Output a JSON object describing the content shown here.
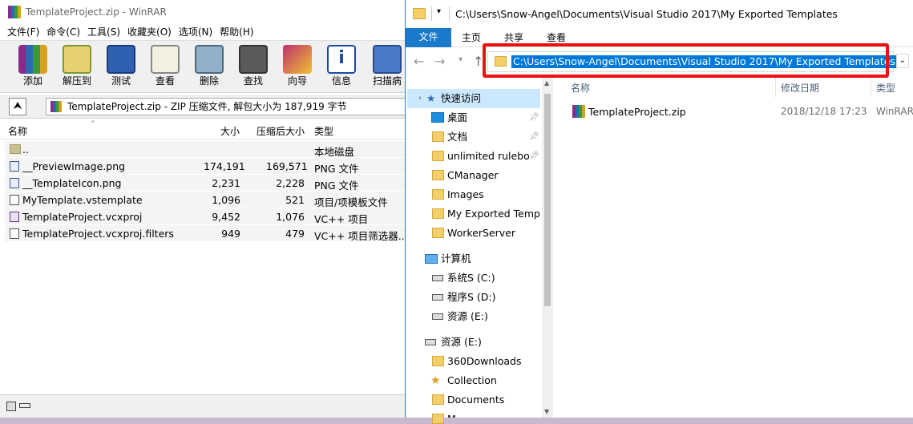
{
  "winrar": {
    "title": "TemplateProject.zip - WinRAR",
    "menu": [
      "文件(F)",
      "命令(C)",
      "工具(S)",
      "收藏夹(O)",
      "选项(N)",
      "帮助(H)"
    ],
    "toolbar": [
      "添加",
      "解压到",
      "测试",
      "查看",
      "删除",
      "查找",
      "向导",
      "信息",
      "扫描病"
    ],
    "path": "TemplateProject.zip - ZIP 压缩文件, 解包大小为 187,919 字节",
    "columns": {
      "name": "名称",
      "size": "大小",
      "packed": "压缩后大小",
      "type": "类型"
    },
    "rows": [
      {
        "name": "..",
        "size": "",
        "packed": "",
        "type": "本地磁盘"
      },
      {
        "name": "__PreviewImage.png",
        "size": "174,191",
        "packed": "169,571",
        "type": "PNG 文件"
      },
      {
        "name": "__TemplateIcon.png",
        "size": "2,231",
        "packed": "2,228",
        "type": "PNG 文件"
      },
      {
        "name": "MyTemplate.vstemplate",
        "size": "1,096",
        "packed": "521",
        "type": "项目/项模板文件"
      },
      {
        "name": "TemplateProject.vcxproj",
        "size": "9,452",
        "packed": "1,076",
        "type": "VC++ 项目"
      },
      {
        "name": "TemplateProject.vcxproj.filters",
        "size": "949",
        "packed": "479",
        "type": "VC++ 项目筛选器..."
      }
    ]
  },
  "explorer": {
    "title": "C:\\Users\\Snow-Angel\\Documents\\Visual Studio 2017\\My Exported Templates",
    "ribbon_tabs": [
      "文件",
      "主页",
      "共享",
      "查看"
    ],
    "address": "C:\\Users\\Snow-Angel\\Documents\\Visual Studio 2017\\My Exported Templates",
    "quick_access_label": "快速访问",
    "quick_access": [
      "桌面",
      "文档",
      "unlimited rulebo",
      "CManager",
      "Images",
      "My Exported Templ",
      "WorkerServer"
    ],
    "computer_label": "计算机",
    "drives": [
      "系统S (C:)",
      "程序S (D:)",
      "资源 (E:)"
    ],
    "drive_e_label": "资源 (E:)",
    "drive_e_items": [
      "360Downloads",
      "Collection",
      "Documents",
      "M..."
    ],
    "columns": {
      "name": "名称",
      "modified": "修改日期",
      "type": "类型"
    },
    "files": [
      {
        "name": "TemplateProject.zip",
        "modified": "2018/12/18 17:23",
        "type": "WinRAR"
      }
    ]
  },
  "colors": {
    "accent": "#1979ca",
    "selection": "#0078d7",
    "highlight_box": "#ee1111"
  }
}
